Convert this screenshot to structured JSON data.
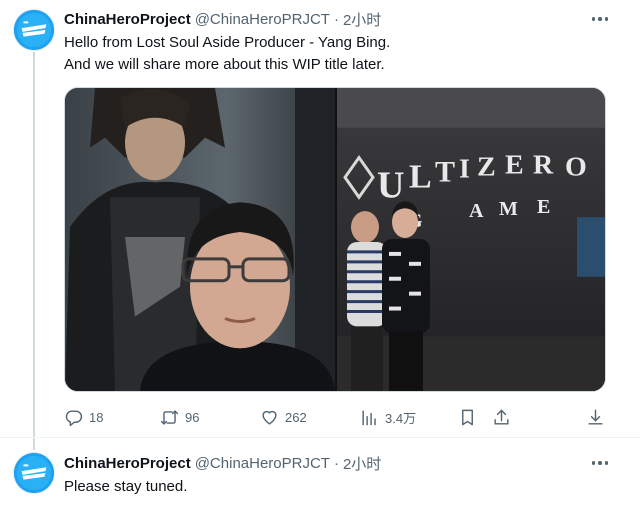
{
  "tweet": {
    "author_name": "ChinaHeroProject",
    "handle": "@ChinaHeroPRJCT",
    "separator": "·",
    "time": "2小时",
    "line1": "Hello from Lost Soul Aside Producer - Yang Bing.",
    "line2": "And we will share more about this WIP title later.",
    "replies": "18",
    "retweets": "96",
    "likes": "262",
    "views": "3.4万"
  },
  "reply": {
    "author_name": "ChinaHeroProject",
    "handle": "@ChinaHeroPRJCT",
    "separator": "·",
    "time": "2小时",
    "text": "Please stay tuned."
  },
  "icons": {
    "more": "more-icon",
    "reply": "reply-icon",
    "retweet": "retweet-icon",
    "like": "heart-icon",
    "views": "views-icon",
    "bookmark": "bookmark-icon",
    "share": "share-icon",
    "download": "download-icon"
  },
  "colors": {
    "text": "#0f1419",
    "secondary": "#536471",
    "avatar_bg": "#1da1f2",
    "line": "#cfd9de"
  }
}
